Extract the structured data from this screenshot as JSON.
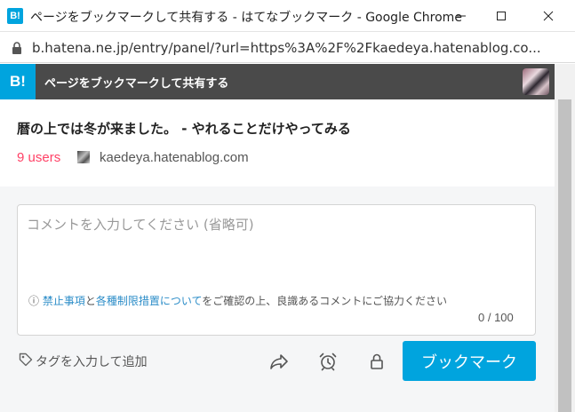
{
  "window": {
    "icon_text": "B!",
    "title": "ページをブックマークして共有する - はてなブックマーク - Google Chrome"
  },
  "urlbar": {
    "url": "b.hatena.ne.jp/entry/panel/?url=https%3A%2F%2Fkaedeya.hatenablog.co..."
  },
  "header": {
    "logo": "B!",
    "title": "ページをブックマークして共有する"
  },
  "entry": {
    "title": "暦の上では冬が来ました。 - やれることだけやってみる",
    "users": "9 users",
    "site": "kaedeya.hatenablog.com"
  },
  "comment": {
    "placeholder": "コメントを入力してください (省略可)",
    "notice_prefix": "ⓘ ",
    "notice_link1": "禁止事項",
    "notice_and": "と",
    "notice_link2": "各種制限措置について",
    "notice_rest": "をご確認の上、良識あるコメントにご協力ください",
    "counter": "0 / 100"
  },
  "actions": {
    "tag_label": "タグを入力して追加",
    "bookmark_label": "ブックマーク"
  },
  "colors": {
    "hatena_blue": "#00a4de",
    "users_red": "#ff4166",
    "header_bg": "#4a4a4a"
  },
  "icons": [
    "lock-icon",
    "tag-icon",
    "share-icon",
    "alarm-icon",
    "private-lock-icon",
    "minimize-icon",
    "maximize-icon",
    "close-icon"
  ]
}
